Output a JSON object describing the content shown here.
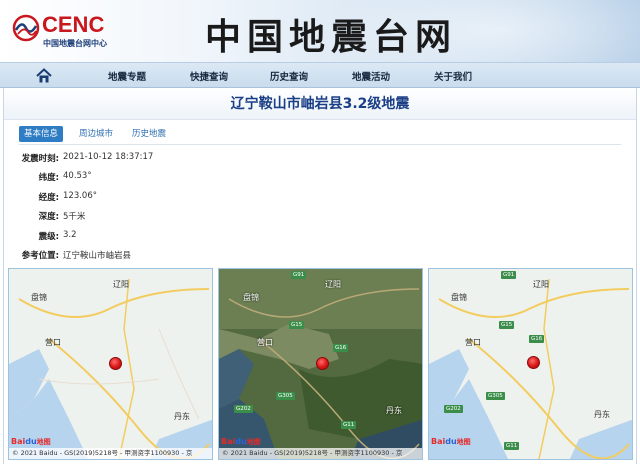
{
  "header": {
    "logo_text": "CENC",
    "logo_subtext": "中国地震台网中心",
    "site_title": "中国地震台网"
  },
  "nav": {
    "items": [
      {
        "label": "地震专题"
      },
      {
        "label": "快捷查询"
      },
      {
        "label": "历史查询"
      },
      {
        "label": "地震活动"
      },
      {
        "label": "关于我们"
      }
    ]
  },
  "page": {
    "title": "辽宁鞍山市岫岩县3.2级地震"
  },
  "tabs": [
    {
      "label": "基本信息",
      "active": true
    },
    {
      "label": "周边城市",
      "active": false
    },
    {
      "label": "历史地震",
      "active": false
    }
  ],
  "info": {
    "time": {
      "label": "发震时刻:",
      "value": "2021-10-12 18:37:17"
    },
    "lat": {
      "label": "纬度:",
      "value": "40.53°"
    },
    "lon": {
      "label": "经度:",
      "value": "123.06°"
    },
    "depth": {
      "label": "深度:",
      "value": "5千米"
    },
    "mag": {
      "label": "震级:",
      "value": "3.2"
    },
    "loc": {
      "label": "参考位置:",
      "value": "辽宁鞍山市岫岩县"
    }
  },
  "maps": {
    "cities": {
      "panjin": "盘锦",
      "liaoyang": "辽阳",
      "yingkou": "营口",
      "dandong": "丹东"
    },
    "roads": {
      "g91": "G91",
      "g15": "G15",
      "g16": "G16",
      "g305": "G305",
      "g202": "G202",
      "g11": "G11"
    },
    "copyright": "© 2021 Baidu - GS(2019)5218号 - 甲测资字1100930 - 京",
    "baidu_logo": {
      "bai": "Bai",
      "du": "du",
      "suffix": "地图"
    }
  },
  "colors": {
    "accent": "#2d7cc4",
    "title": "#1a3f86",
    "quake": "#d91616"
  }
}
